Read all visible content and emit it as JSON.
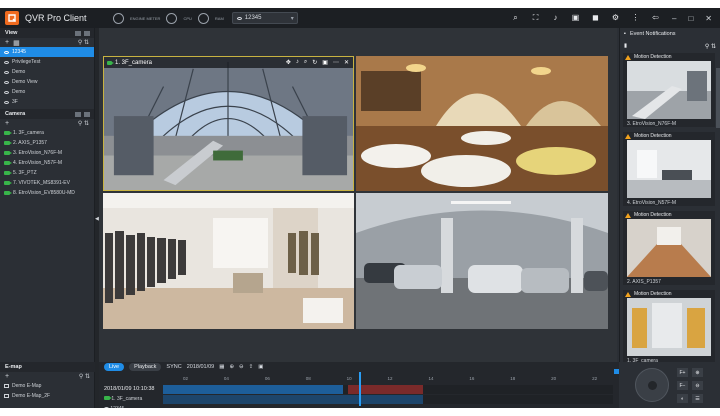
{
  "app": {
    "title": "QVR Pro Client",
    "storage_label": "ENGINE METER",
    "cpu_label": "CPU",
    "ram_label": "RAM"
  },
  "toolbar": {
    "selected_view": "12345",
    "icons": [
      "search-icon",
      "fullscreen-icon",
      "volume-icon",
      "screenshot-icon",
      "record-icon",
      "settings-icon",
      "more-icon",
      "logout-icon"
    ],
    "window_controls": [
      "minimize",
      "maximize",
      "close"
    ]
  },
  "view_panel": {
    "title": "View",
    "items": [
      {
        "label": "12345",
        "active": true
      },
      {
        "label": "PrivilegeTest"
      },
      {
        "label": "Demo"
      },
      {
        "label": "Demo View"
      },
      {
        "label": "Demo"
      },
      {
        "label": "3F"
      }
    ]
  },
  "camera_panel": {
    "title": "Camera",
    "items": [
      "1. 3F_camera",
      "2. AXIS_P1357",
      "3. EtroVision_N76F-M",
      "4. EtroVision_N57F-M",
      "5. 3F_PTZ",
      "7. VIVOTEK_MS8391-EV",
      "8. EtroVision_EV8580U-MD"
    ]
  },
  "emap_panel": {
    "title": "E-map",
    "items": [
      "Demo E-Map",
      "Demo E-Map_2F"
    ]
  },
  "live": {
    "panes": [
      {
        "label": "1. 3F_camera",
        "selected": true
      },
      {
        "label": ""
      },
      {
        "label": ""
      },
      {
        "label": ""
      }
    ]
  },
  "events": {
    "title": "Event Notifications",
    "cards": [
      {
        "type": "Motion Detection",
        "camera": "3. EtroVision_N76F-M"
      },
      {
        "type": "Motion Detection",
        "camera": "4. EtroVision_N57F-M"
      },
      {
        "type": "Motion Detection",
        "camera": "2. AXIS_P1357"
      },
      {
        "type": "Motion Detection",
        "camera": "1. 3F_camera"
      }
    ]
  },
  "timeline": {
    "live_label": "Live",
    "playback_label": "Playback",
    "sync_label": "SYNC",
    "date": "2018/01/09",
    "timestamp": "2018/01/09 10:10:38",
    "rows": [
      "1. 3F_camera",
      "12345"
    ],
    "ticks": [
      "02",
      "04",
      "06",
      "08",
      "10",
      "12",
      "14",
      "16",
      "18",
      "20",
      "22"
    ]
  },
  "colors": {
    "accent": "#1f8ce6",
    "camera_ok": "#38b54a",
    "warning": "#f1a21d",
    "brand": "#f06b1f"
  }
}
